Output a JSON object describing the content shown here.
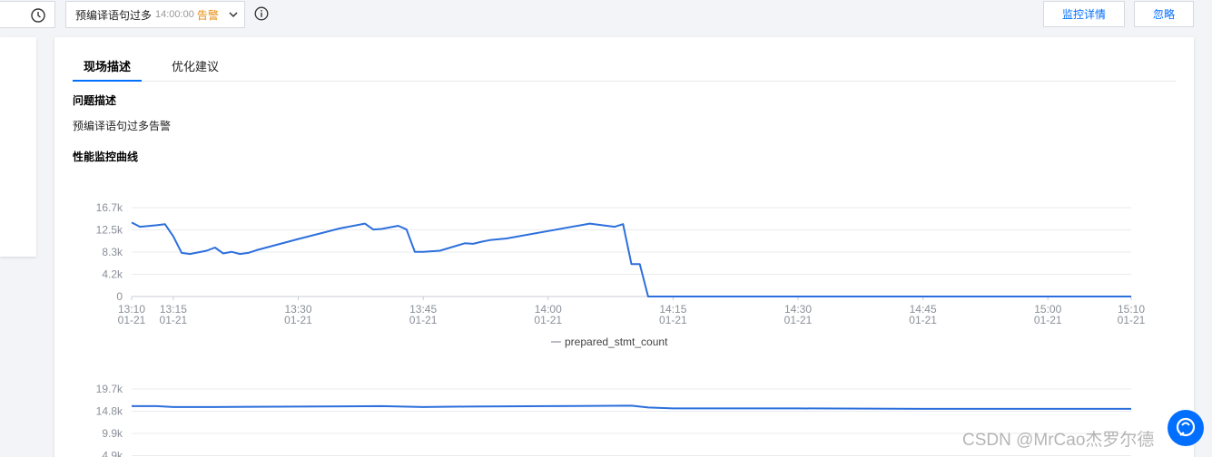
{
  "toolbar": {
    "alert_select": {
      "name": "预编译语句过多",
      "time": "14:00:00",
      "level": "告警",
      "level_color": "#e58d12"
    },
    "detail_button": "监控详情",
    "ignore_button": "忽略",
    "icons": [
      "clock-icon",
      "chevron-down-icon",
      "info-icon"
    ]
  },
  "tabs": [
    {
      "label": "现场描述",
      "active": true
    },
    {
      "label": "优化建议",
      "active": false
    }
  ],
  "problem": {
    "title": "问题描述",
    "text": "预编译语句过多告警"
  },
  "monitor": {
    "title": "性能监控曲线"
  },
  "accent_color": "#006eff",
  "line_color": "#2c6fdc",
  "chart_data": [
    {
      "type": "line",
      "y_ticks": [
        "16.7k",
        "12.5k",
        "8.3k",
        "4.2k",
        "0"
      ],
      "ylim": [
        0,
        16700
      ],
      "x_ticks": [
        {
          "time": "13:10",
          "date": "01-21"
        },
        {
          "time": "13:15",
          "date": "01-21"
        },
        {
          "time": "13:30",
          "date": "01-21"
        },
        {
          "time": "13:45",
          "date": "01-21"
        },
        {
          "time": "14:00",
          "date": "01-21"
        },
        {
          "time": "14:15",
          "date": "01-21"
        },
        {
          "time": "14:30",
          "date": "01-21"
        },
        {
          "time": "14:45",
          "date": "01-21"
        },
        {
          "time": "15:00",
          "date": "01-21"
        },
        {
          "time": "15:10",
          "date": "01-21"
        }
      ],
      "series": [
        {
          "name": "prepared_stmt_count",
          "x": [
            "13:10",
            "13:11",
            "13:13",
            "13:14",
            "13:15",
            "13:16",
            "13:17",
            "13:19",
            "13:20",
            "13:21",
            "13:22",
            "13:23",
            "13:24",
            "13:25",
            "13:30",
            "13:35",
            "13:38",
            "13:39",
            "13:40",
            "13:42",
            "13:43",
            "13:44",
            "13:45",
            "13:47",
            "13:50",
            "13:51",
            "13:52",
            "13:53",
            "13:55",
            "14:00",
            "14:05",
            "14:08",
            "14:09",
            "14:10",
            "14:11",
            "14:12",
            "14:13",
            "14:14",
            "14:15",
            "14:30",
            "14:45",
            "15:00",
            "15:10"
          ],
          "values": [
            13900,
            13100,
            13400,
            13600,
            11300,
            8200,
            8000,
            8600,
            9200,
            8100,
            8400,
            8000,
            8200,
            8700,
            10800,
            12800,
            13700,
            12600,
            12700,
            13300,
            12600,
            8400,
            8400,
            8600,
            10000,
            9900,
            10300,
            10600,
            10900,
            12300,
            13700,
            13100,
            13600,
            6100,
            6100,
            0,
            0,
            0,
            0,
            0,
            0,
            0,
            0
          ]
        }
      ]
    },
    {
      "type": "line",
      "y_ticks": [
        "19.7k",
        "14.8k",
        "9.9k",
        "4.9k"
      ],
      "ylim": [
        0,
        19700
      ],
      "series": [
        {
          "x": [
            "13:10",
            "13:13",
            "13:15",
            "13:20",
            "13:30",
            "13:40",
            "13:45",
            "13:50",
            "14:00",
            "14:10",
            "14:12",
            "14:15",
            "14:30",
            "14:45",
            "15:00",
            "15:10"
          ],
          "values": [
            15900,
            15900,
            15700,
            15700,
            15800,
            15900,
            15700,
            15800,
            15900,
            16000,
            15600,
            15400,
            15400,
            15300,
            15300,
            15300
          ]
        }
      ]
    }
  ],
  "watermark": "CSDN @MrCao杰罗尔德"
}
